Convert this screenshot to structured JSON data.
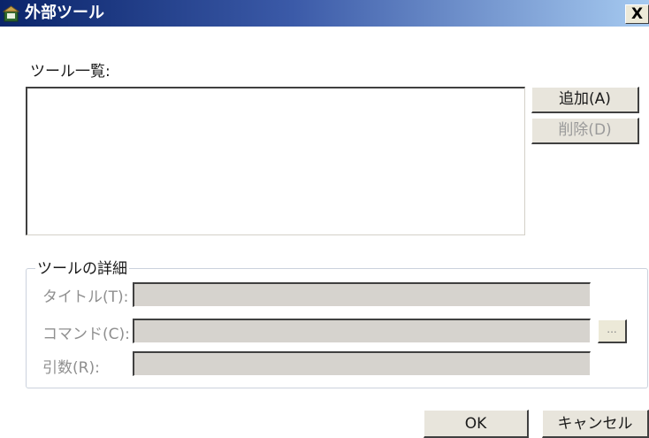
{
  "window": {
    "title": "外部ツール",
    "icon": "tools-window-icon",
    "close_label": "X"
  },
  "tool_list": {
    "label": "ツール一覧:",
    "items": []
  },
  "buttons": {
    "add_label": "追加(A)",
    "delete_label": "削除(D)",
    "browse_label": "...",
    "ok_label": "OK",
    "cancel_label": "キャンセル"
  },
  "details": {
    "group_label": "ツールの詳細",
    "title_label": "タイトル(T):",
    "title_value": "",
    "command_label": "コマンド(C):",
    "command_value": "",
    "args_label": "引数(R):",
    "args_value": ""
  },
  "colors": {
    "titlebar_start": "#0a246a",
    "titlebar_end": "#a6caf0",
    "disabled_text": "#9a9a9a",
    "disabled_field": "#d6d3ce"
  }
}
